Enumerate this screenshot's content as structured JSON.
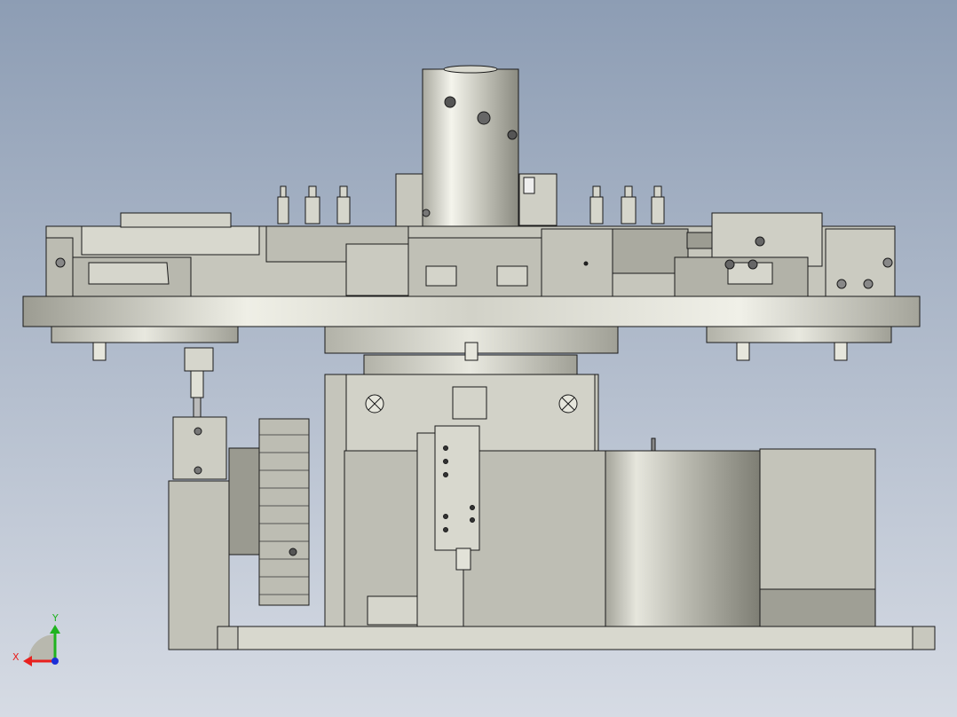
{
  "viewport": {
    "background_top": "#8d9db4",
    "background_bottom": "#d6dbe4",
    "edge_color": "#1a1a1a",
    "metal_light": "#f2f2ea",
    "metal_mid": "#c9c9bf",
    "metal_dark": "#8e8e84"
  },
  "triad": {
    "x_label": "X",
    "y_label": "Y",
    "x_color": "#e8201e",
    "y_color": "#1fb31f",
    "z_color": "#1c2fd8"
  }
}
